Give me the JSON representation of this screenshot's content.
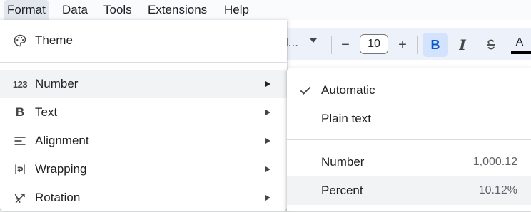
{
  "menubar": {
    "items": [
      {
        "label": "Format"
      },
      {
        "label": "Data"
      },
      {
        "label": "Tools"
      },
      {
        "label": "Extensions"
      },
      {
        "label": "Help"
      }
    ]
  },
  "toolbar": {
    "font_label": "l...",
    "decrease_label": "−",
    "font_size": "10",
    "increase_label": "+",
    "bold_label": "B",
    "italic_label": "I",
    "strike_label": "S",
    "text_color_label": "A"
  },
  "format_menu": {
    "theme": {
      "label": "Theme",
      "icon": "palette-icon"
    },
    "items": [
      {
        "label": "Number",
        "icon": "number-123-icon",
        "icon_text": "123"
      },
      {
        "label": "Text",
        "icon": "bold-icon",
        "icon_text": "B"
      },
      {
        "label": "Alignment",
        "icon": "align-left-icon"
      },
      {
        "label": "Wrapping",
        "icon": "text-wrap-icon"
      },
      {
        "label": "Rotation",
        "icon": "text-rotation-icon"
      }
    ]
  },
  "number_submenu": {
    "items": [
      {
        "label": "Automatic",
        "checked": true,
        "example": ""
      },
      {
        "label": "Plain text",
        "checked": false,
        "example": ""
      },
      {
        "label": "Number",
        "checked": false,
        "example": "1,000.12"
      },
      {
        "label": "Percent",
        "checked": false,
        "example": "10.12%"
      }
    ]
  },
  "colors": {
    "menubar_bg": "#f9fbfd",
    "hover_bg": "#f1f3f4",
    "toolbar_bg": "#edf2fa",
    "bold_active_bg": "#d3e3fd",
    "bold_active_fg": "#0b57d0"
  }
}
